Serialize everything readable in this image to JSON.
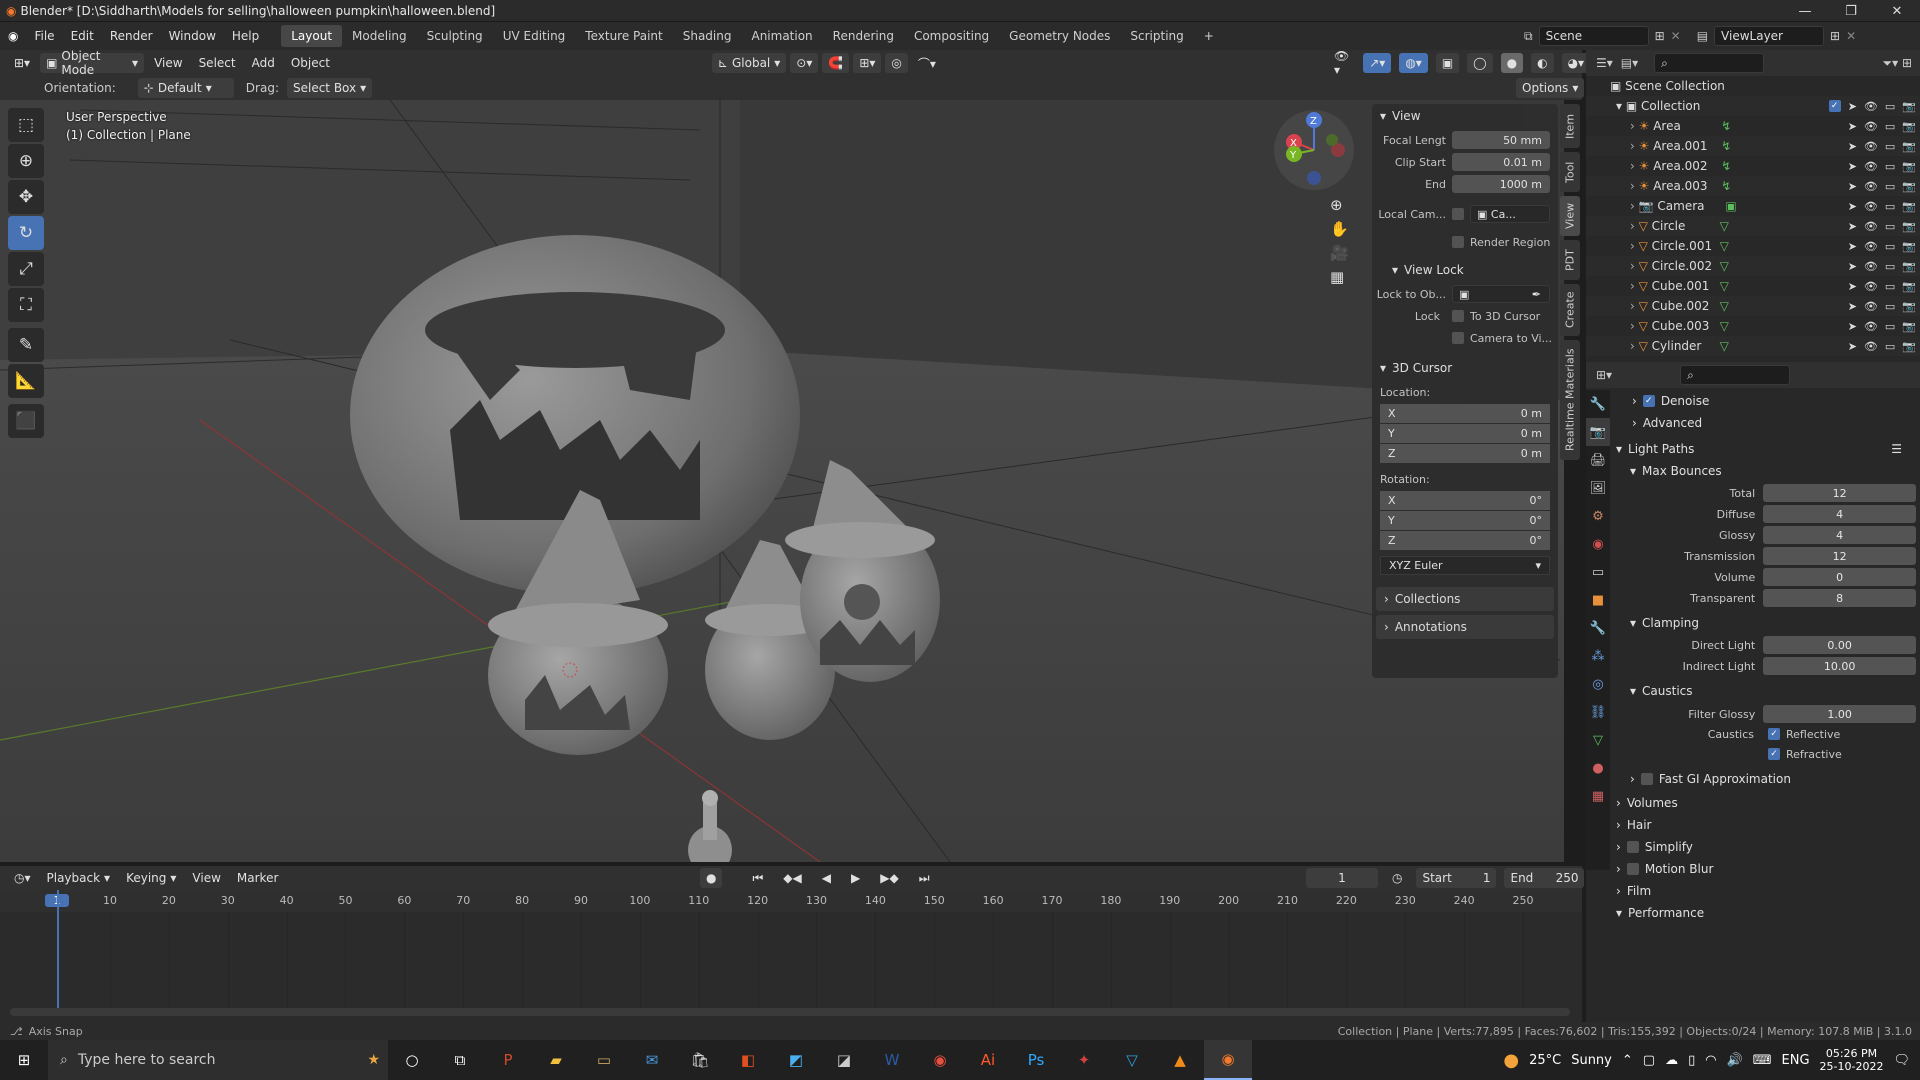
{
  "titlebar": {
    "title": "Blender* [D:\\Siddharth\\Models for selling\\halloween pumpkin\\halloween.blend]",
    "min": "—",
    "max": "❐",
    "close": "✕"
  },
  "menubar": {
    "menus": [
      "File",
      "Edit",
      "Render",
      "Window",
      "Help"
    ],
    "workspaces": [
      "Layout",
      "Modeling",
      "Sculpting",
      "UV Editing",
      "Texture Paint",
      "Shading",
      "Animation",
      "Rendering",
      "Compositing",
      "Geometry Nodes",
      "Scripting"
    ],
    "add_ws": "+",
    "scene": "Scene",
    "view_layer": "ViewLayer"
  },
  "vp_header": {
    "mode": "Object Mode",
    "menus": [
      "View",
      "Select",
      "Add",
      "Object"
    ],
    "transform": "Global",
    "options": "Options"
  },
  "tool_header": {
    "orientation_label": "Orientation:",
    "orientation": "Default",
    "drag_label": "Drag:",
    "drag": "Select Box"
  },
  "viewport": {
    "view_name": "User Perspective",
    "collection": "(1) Collection | Plane",
    "gizmo": {
      "x": "X",
      "y": "Y",
      "z": "Z"
    }
  },
  "npanel": {
    "view_title": "View",
    "focal_label": "Focal Lengt",
    "focal": "50 mm",
    "clip_start_label": "Clip Start",
    "clip_start": "0.01 m",
    "end_label": "End",
    "end": "1000 m",
    "local_cam_label": "Local Cam...",
    "local_cam": "Ca...",
    "render_region": "Render Region",
    "view_lock": "View Lock",
    "lock_obj_label": "Lock to Ob...",
    "lock_label": "Lock",
    "to_cursor": "To 3D Cursor",
    "cam_to_view": "Camera to Vi...",
    "cursor_title": "3D Cursor",
    "location": "Location:",
    "rotation": "Rotation:",
    "loc": [
      {
        "axis": "X",
        "val": "0 m"
      },
      {
        "axis": "Y",
        "val": "0 m"
      },
      {
        "axis": "Z",
        "val": "0 m"
      }
    ],
    "rot": [
      {
        "axis": "X",
        "val": "0°"
      },
      {
        "axis": "Y",
        "val": "0°"
      },
      {
        "axis": "Z",
        "val": "0°"
      }
    ],
    "rot_mode": "XYZ Euler",
    "collections": "Collections",
    "annotations": "Annotations"
  },
  "sidetabs": [
    "Item",
    "Tool",
    "View",
    "PDT",
    "Create",
    "Realtime Materials"
  ],
  "outliner": {
    "root": "Scene Collection",
    "collection": "Collection",
    "items": [
      {
        "name": "Area",
        "kind": "light"
      },
      {
        "name": "Area.001",
        "kind": "light"
      },
      {
        "name": "Area.002",
        "kind": "light"
      },
      {
        "name": "Area.003",
        "kind": "light"
      },
      {
        "name": "Camera",
        "kind": "camera"
      },
      {
        "name": "Circle",
        "kind": "mesh"
      },
      {
        "name": "Circle.001",
        "kind": "mesh"
      },
      {
        "name": "Circle.002",
        "kind": "mesh"
      },
      {
        "name": "Cube.001",
        "kind": "mesh"
      },
      {
        "name": "Cube.002",
        "kind": "mesh"
      },
      {
        "name": "Cube.003",
        "kind": "mesh"
      },
      {
        "name": "Cylinder",
        "kind": "mesh"
      }
    ]
  },
  "props": {
    "denoise": "Denoise",
    "advanced": "Advanced",
    "light_paths": "Light Paths",
    "max_bounces": "Max Bounces",
    "bounces": [
      {
        "label": "Total",
        "val": "12"
      },
      {
        "label": "Diffuse",
        "val": "4"
      },
      {
        "label": "Glossy",
        "val": "4"
      },
      {
        "label": "Transmission",
        "val": "12"
      },
      {
        "label": "Volume",
        "val": "0"
      },
      {
        "label": "Transparent",
        "val": "8"
      }
    ],
    "clamping": "Clamping",
    "clamp": [
      {
        "label": "Direct Light",
        "val": "0.00"
      },
      {
        "label": "Indirect Light",
        "val": "10.00"
      }
    ],
    "caustics": "Caustics",
    "filter_glossy_label": "Filter Glossy",
    "filter_glossy": "1.00",
    "caustics_label": "Caustics",
    "reflective": "Reflective",
    "refractive": "Refractive",
    "fast_gi": "Fast GI Approximation",
    "sections": [
      "Volumes",
      "Hair",
      "Simplify",
      "Motion Blur",
      "Film",
      "Performance"
    ]
  },
  "timeline": {
    "menus": [
      "Playback",
      "Keying",
      "View",
      "Marker"
    ],
    "current": "1",
    "start_label": "Start",
    "start": "1",
    "end_label": "End",
    "end": "250",
    "ticks": [
      "1",
      "10",
      "20",
      "30",
      "40",
      "50",
      "60",
      "70",
      "80",
      "90",
      "100",
      "110",
      "120",
      "130",
      "140",
      "150",
      "160",
      "170",
      "180",
      "190",
      "200",
      "210",
      "220",
      "230",
      "240",
      "250"
    ]
  },
  "statusbar": {
    "left": "Axis Snap",
    "right": "Collection | Plane | Verts:77,895 | Faces:76,602 | Tris:155,392 | Objects:0/24 | Memory: 107.8 MiB | 3.1.0"
  },
  "taskbar": {
    "search": "Type here to search",
    "temp": "25°C",
    "weather": "Sunny",
    "lang": "ENG",
    "time": "05:26 PM",
    "date": "25-10-2022"
  }
}
